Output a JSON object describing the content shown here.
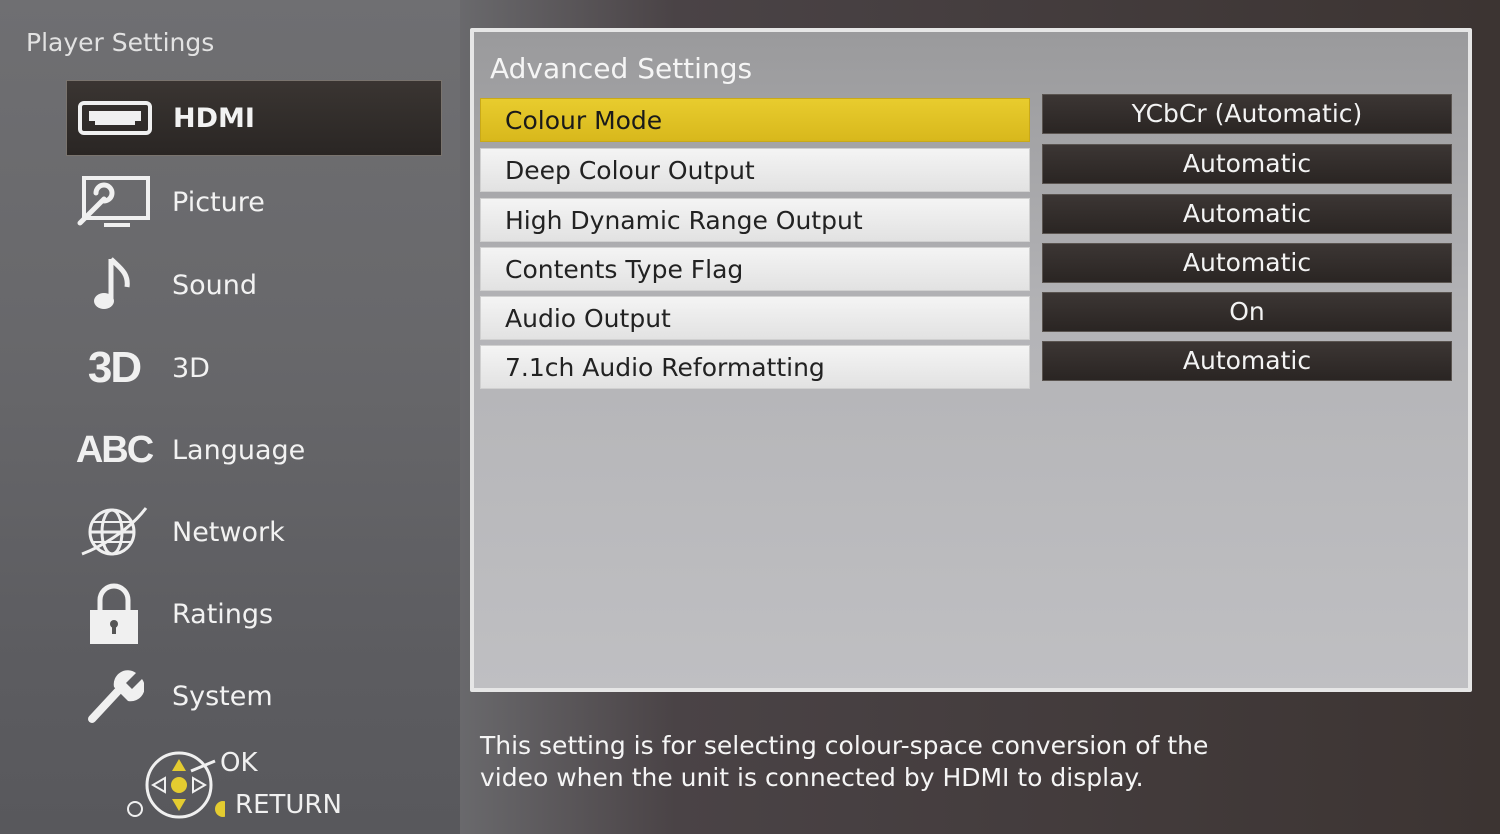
{
  "sidebar": {
    "title": "Player Settings",
    "items": [
      {
        "label": "HDMI",
        "icon": "hdmi-icon",
        "selected": true
      },
      {
        "label": "Picture",
        "icon": "picture-icon"
      },
      {
        "label": "Sound",
        "icon": "music-note-icon"
      },
      {
        "label": "3D",
        "icon": "3d-icon",
        "icon_text": "3D"
      },
      {
        "label": "Language",
        "icon": "language-icon",
        "icon_text": "ABC"
      },
      {
        "label": "Network",
        "icon": "globe-icon"
      },
      {
        "label": "Ratings",
        "icon": "lock-icon"
      },
      {
        "label": "System",
        "icon": "wrench-icon"
      }
    ]
  },
  "nav": {
    "ok_label": "OK",
    "return_label": "RETURN"
  },
  "panel": {
    "title": "Advanced Settings",
    "settings": [
      {
        "label": "Colour Mode",
        "value": "YCbCr (Automatic)",
        "selected": true
      },
      {
        "label": "Deep Colour Output",
        "value": "Automatic"
      },
      {
        "label": "High Dynamic Range Output",
        "value": "Automatic"
      },
      {
        "label": "Contents Type Flag",
        "value": "Automatic"
      },
      {
        "label": "Audio Output",
        "value": "On"
      },
      {
        "label": "7.1ch Audio Reformatting",
        "value": "Automatic"
      }
    ]
  },
  "description": {
    "line1": "This setting is for selecting colour-space conversion of the",
    "line2": "video when the unit is connected by HDMI to display."
  },
  "colors": {
    "highlight": "#e0c024",
    "value_bg": "#2f2a28",
    "sidebar_bg": "#6a6a6d"
  }
}
